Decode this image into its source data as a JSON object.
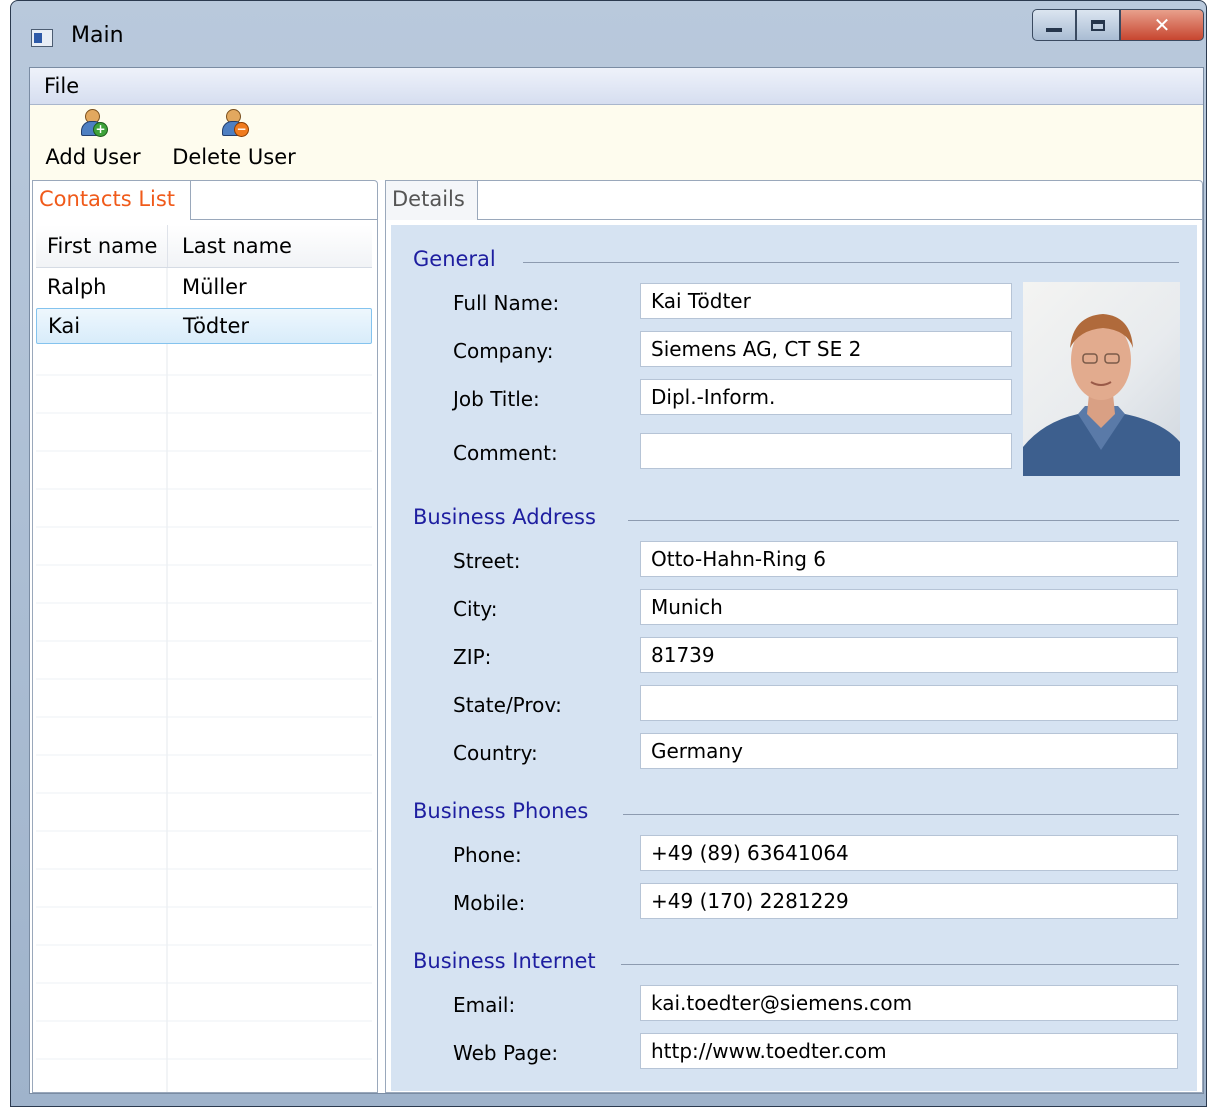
{
  "window": {
    "title": "Main"
  },
  "menu": {
    "file": "File"
  },
  "toolbar": {
    "add_user": "Add User",
    "delete_user": "Delete User"
  },
  "left_tab": {
    "label": "Contacts List"
  },
  "contacts": {
    "columns": {
      "first": "First name",
      "last": "Last name"
    },
    "rows": [
      {
        "first": "Ralph",
        "last": "Müller"
      },
      {
        "first": "Kai",
        "last": "Tödter"
      }
    ],
    "selected_index": 1
  },
  "right_tab": {
    "label": "Details"
  },
  "details": {
    "general": {
      "title": "General",
      "full_name_label": "Full Name:",
      "full_name": "Kai Tödter",
      "company_label": "Company:",
      "company": "Siemens AG, CT SE 2",
      "job_title_label": "Job Title:",
      "job_title": "Dipl.-Inform.",
      "comment_label": "Comment:",
      "comment": ""
    },
    "address": {
      "title": "Business Address",
      "street_label": "Street:",
      "street": "Otto-Hahn-Ring 6",
      "city_label": "City:",
      "city": "Munich",
      "zip_label": "ZIP:",
      "zip": "81739",
      "state_label": "State/Prov:",
      "state": "",
      "country_label": "Country:",
      "country": "Germany"
    },
    "phones": {
      "title": "Business Phones",
      "phone_label": "Phone:",
      "phone": "+49 (89) 63641064",
      "mobile_label": "Mobile:",
      "mobile": "+49 (170) 2281229"
    },
    "internet": {
      "title": "Business Internet",
      "email_label": "Email:",
      "email": "kai.toedter@siemens.com",
      "web_label": "Web Page:",
      "web": "http://www.toedter.com"
    }
  },
  "colors": {
    "tab_active_text": "#f05a1a",
    "group_title": "#1e1ea0",
    "details_bg": "#d6e3f2",
    "toolbar_bg": "#fefcee"
  }
}
